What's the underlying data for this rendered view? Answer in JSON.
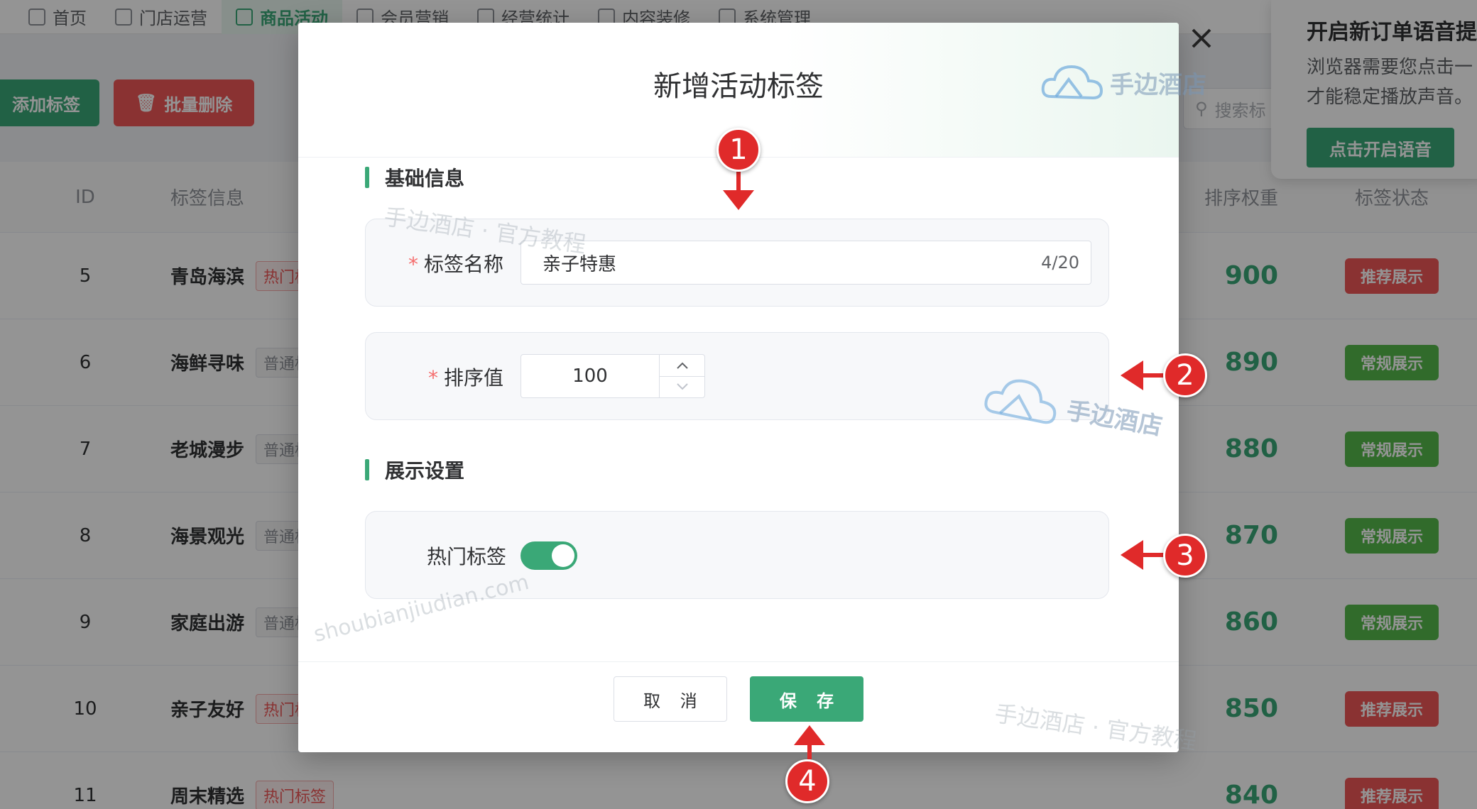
{
  "nav": {
    "items": [
      {
        "label": "首页",
        "icon": "home-icon",
        "active": false
      },
      {
        "label": "门店运营",
        "icon": "store-icon",
        "active": false
      },
      {
        "label": "商品活动",
        "icon": "shop-icon",
        "active": true
      },
      {
        "label": "会员营销",
        "icon": "user-icon",
        "active": false
      },
      {
        "label": "经营统计",
        "icon": "chart-icon",
        "active": false
      },
      {
        "label": "内容装修",
        "icon": "layout-icon",
        "active": false
      },
      {
        "label": "系统管理",
        "icon": "gear-icon",
        "active": false
      }
    ]
  },
  "toolbar": {
    "add_label": "添加标签",
    "delete_label": "批量删除",
    "search_placeholder": "搜索标"
  },
  "table": {
    "headers": {
      "id": "ID",
      "info": "标签信息",
      "sort": "排序权重",
      "state": "标签状态"
    },
    "rows": [
      {
        "id": "5",
        "name": "青岛海滨",
        "tag": "热门标签",
        "hot": true,
        "sort": "900",
        "state": "推荐展示"
      },
      {
        "id": "6",
        "name": "海鲜寻味",
        "tag": "普通标签",
        "hot": false,
        "sort": "890",
        "state": "常规展示"
      },
      {
        "id": "7",
        "name": "老城漫步",
        "tag": "普通标签",
        "hot": false,
        "sort": "880",
        "state": "常规展示"
      },
      {
        "id": "8",
        "name": "海景观光",
        "tag": "普通标签",
        "hot": false,
        "sort": "870",
        "state": "常规展示"
      },
      {
        "id": "9",
        "name": "家庭出游",
        "tag": "普通标签",
        "hot": false,
        "sort": "860",
        "state": "常规展示"
      },
      {
        "id": "10",
        "name": "亲子友好",
        "tag": "热门标签",
        "hot": true,
        "sort": "850",
        "state": "推荐展示"
      },
      {
        "id": "11",
        "name": "周末精选",
        "tag": "热门标签",
        "hot": true,
        "sort": "840",
        "state": "推荐展示"
      }
    ]
  },
  "notice": {
    "title": "开启新订单语音提",
    "desc1": "浏览器需要您点击一",
    "desc2": "才能稳定播放声音。",
    "button": "点击开启语音"
  },
  "dialog": {
    "title": "新增活动标签",
    "section_basic": "基础信息",
    "section_display": "展示设置",
    "name_label": "标签名称",
    "name_value": "亲子特惠",
    "name_count": "4/20",
    "sort_label": "排序值",
    "sort_value": "100",
    "hot_label": "热门标签",
    "hot_on": true,
    "cancel": "取 消",
    "save": "保 存"
  },
  "watermarks": {
    "brand": "手边酒店",
    "tutorial": "手边酒店 · 官方教程",
    "domain": "shoubianjiudian.com"
  },
  "markers": [
    "1",
    "2",
    "3",
    "4"
  ],
  "colors": {
    "accent": "#3aa877",
    "danger": "#ee5656",
    "marker": "#e02a2a"
  }
}
